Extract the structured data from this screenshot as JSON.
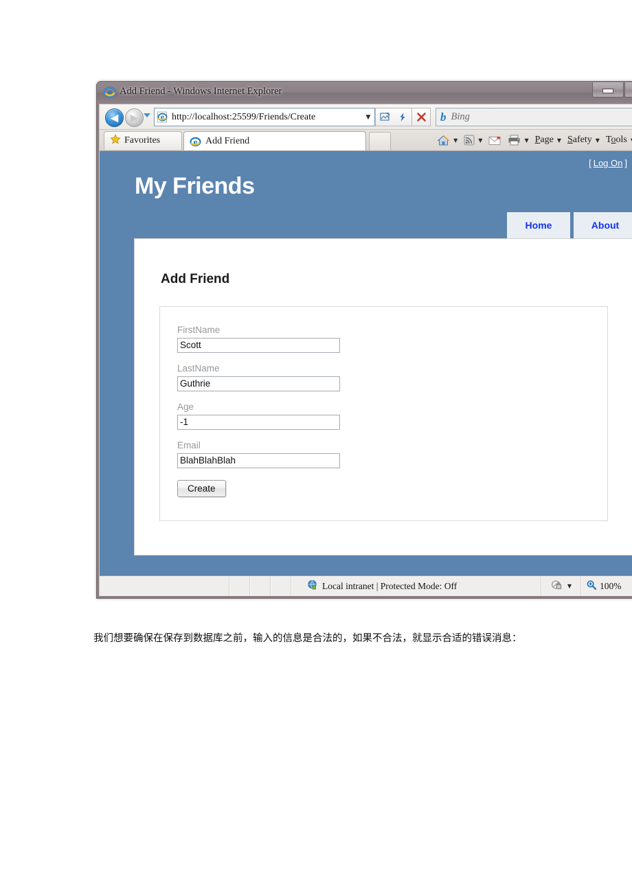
{
  "browser": {
    "title": "Add Friend - Windows Internet Explorer",
    "title_icon": "ie-logo-icon",
    "window_buttons": [
      {
        "name": "minimize-button",
        "glyph": "minimize-icon"
      },
      {
        "name": "maximize-button",
        "glyph": "maximize-icon"
      }
    ],
    "nav": {
      "back": "back-arrow-icon",
      "forward": "forward-arrow-icon",
      "recent_pages": "chevron-down-icon",
      "address_icon": "ie-page-icon",
      "address_value": "http://localhost:25599/Friends/Create",
      "address_dropdown": "chevron-down-icon",
      "compatibility_button": "compatibility-view-icon",
      "refresh_button": "refresh-icon",
      "stop_button": "stop-icon",
      "search_engine": "b",
      "search_placeholder": "Bing"
    },
    "tabs": {
      "favorites_label": "Favorites",
      "favorites_icon": "star-icon",
      "page_tab_label": "Add Friend",
      "page_tab_icon": "ie-page-icon",
      "new_tab_label": ""
    },
    "command_bar": [
      {
        "name": "home-button",
        "icon": "home-icon",
        "label": "",
        "caret": true
      },
      {
        "name": "feeds-button",
        "icon": "rss-icon",
        "label": "",
        "caret": true
      },
      {
        "name": "mail-button",
        "icon": "mail-icon",
        "label": "",
        "caret": false
      },
      {
        "name": "print-button",
        "icon": "printer-icon",
        "label": "",
        "caret": true
      },
      {
        "name": "page-menu",
        "icon": "",
        "label": "Page",
        "caret": true
      },
      {
        "name": "safety-menu",
        "icon": "",
        "label": "Safety",
        "caret": true
      },
      {
        "name": "tools-menu",
        "icon": "",
        "label": "Tools",
        "caret": true
      }
    ],
    "status_bar": {
      "zone_icon": "globe-icon",
      "zone_text": "Local intranet | Protected Mode: Off",
      "protected_icon": "privacy-lock-icon",
      "protected_caret": "chevron-down-icon",
      "zoom_icon": "magnifier-icon",
      "zoom_level": "100%"
    }
  },
  "page": {
    "log_on": {
      "open_bracket": "[",
      "link_label": "Log On",
      "close_bracket": "]"
    },
    "site_title": "My Friends",
    "nav_tabs": [
      {
        "name": "nav-tab-home",
        "label": "Home"
      },
      {
        "name": "nav-tab-about",
        "label": "About"
      }
    ],
    "heading": "Add Friend",
    "form": {
      "fields": [
        {
          "name": "firstname",
          "label": "FirstName",
          "value": "Scott"
        },
        {
          "name": "lastname",
          "label": "LastName",
          "value": "Guthrie"
        },
        {
          "name": "age",
          "label": "Age",
          "value": "-1"
        },
        {
          "name": "email",
          "label": "Email",
          "value": "BlahBlahBlah"
        }
      ],
      "submit_label": "Create"
    }
  },
  "document": {
    "caption": "我们想要确保在保存到数据库之前，输入的信息是合法的，如果不合法，就显示合适的错误消息："
  },
  "colors": {
    "header_blue": "#5b84af",
    "nav_tab_bg": "#e8eef4",
    "nav_tab_text": "#1433f0",
    "page_white": "#ffffff",
    "label_gray": "#999999"
  }
}
